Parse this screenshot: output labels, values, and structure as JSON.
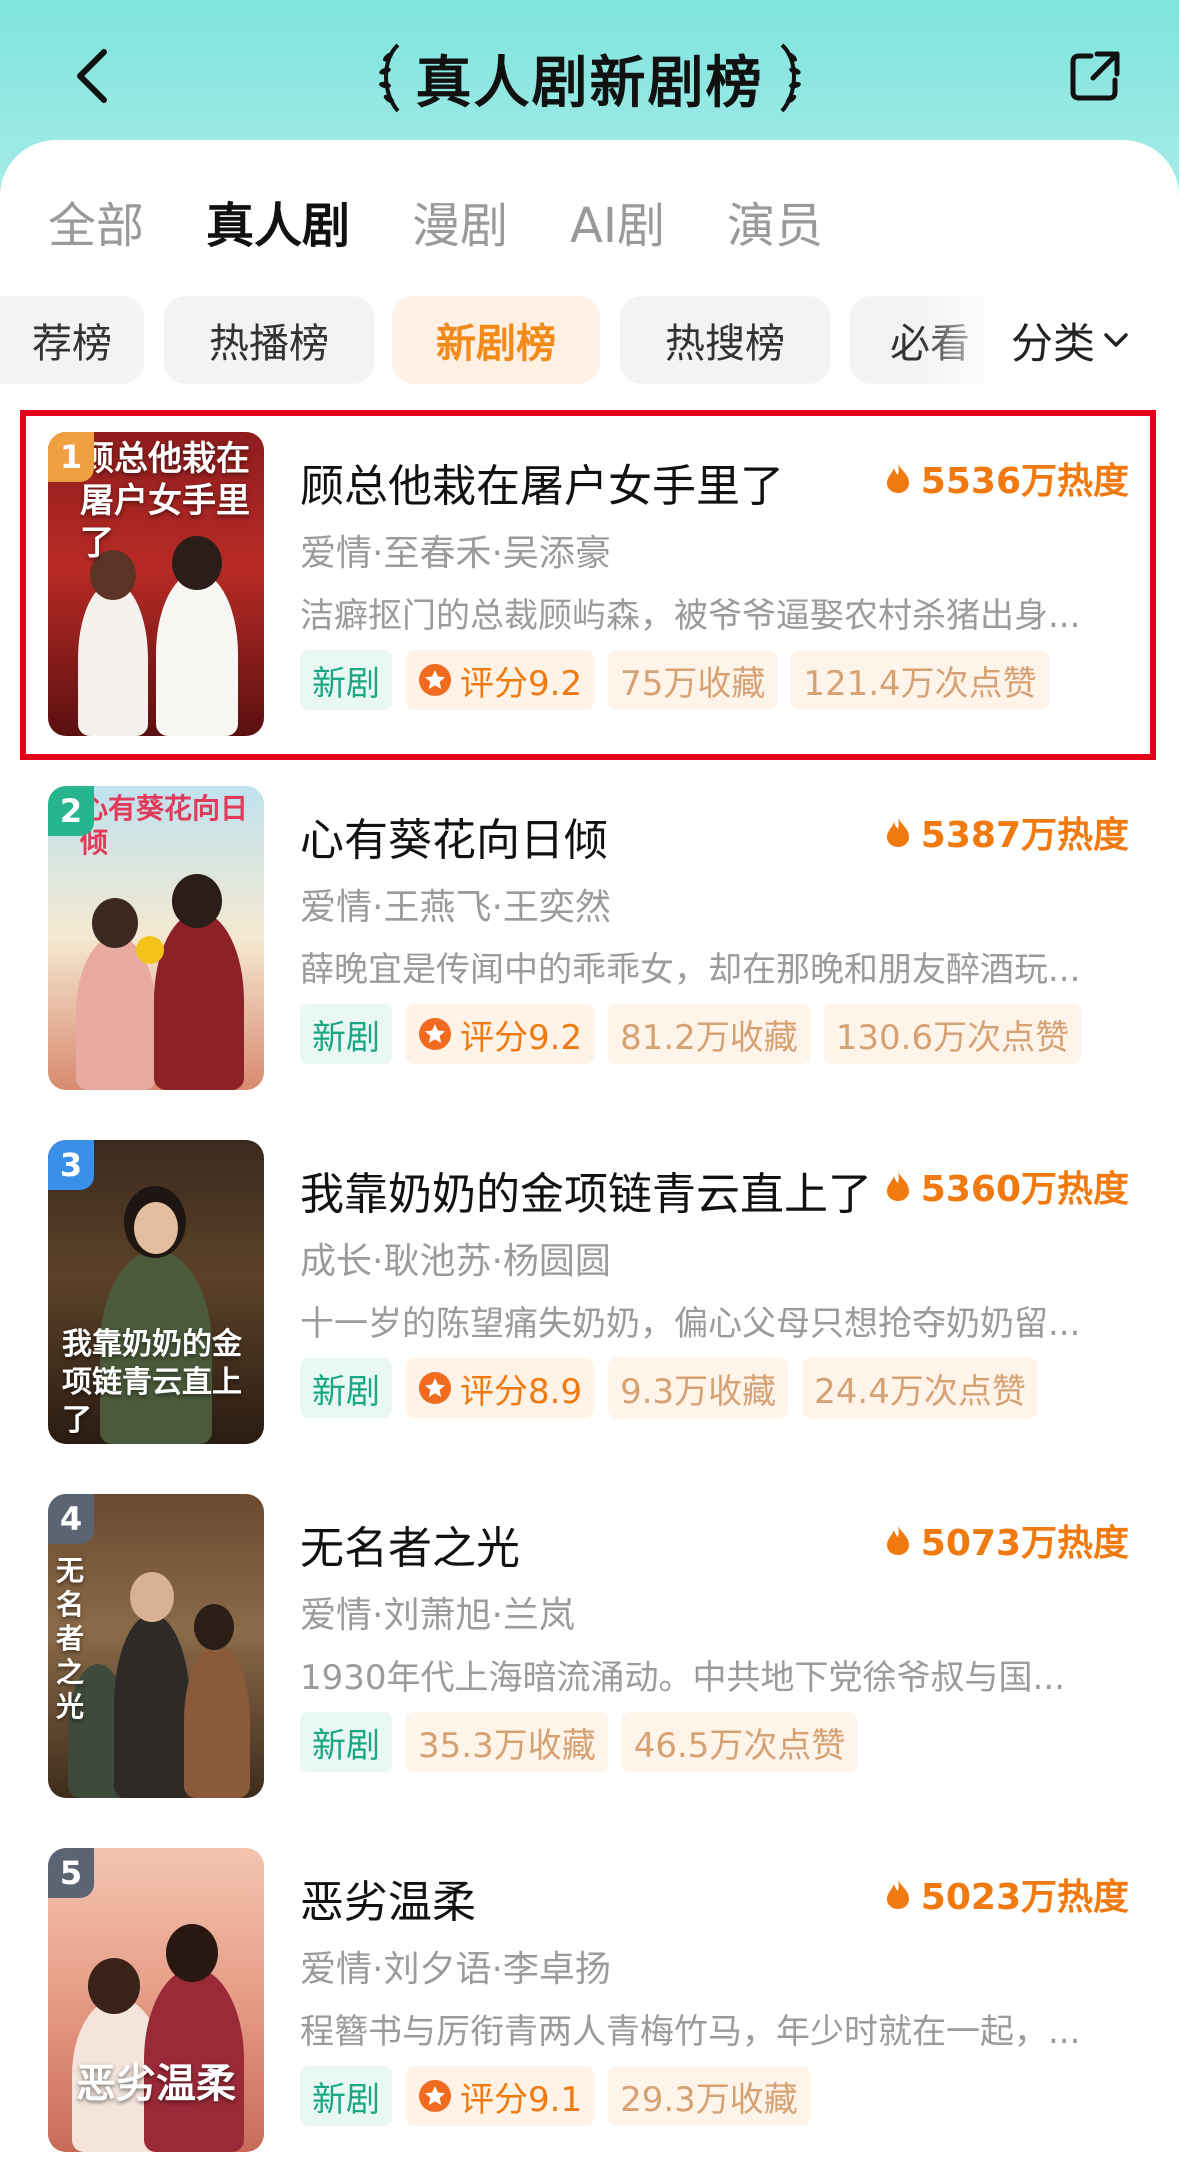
{
  "header": {
    "title": "真人剧新剧榜",
    "back_icon": "chevron-left-icon",
    "share_icon": "share-icon"
  },
  "main_tabs": [
    {
      "label": "全部",
      "active": false
    },
    {
      "label": "真人剧",
      "active": true
    },
    {
      "label": "漫剧",
      "active": false
    },
    {
      "label": "AI剧",
      "active": false
    },
    {
      "label": "演员",
      "active": false
    }
  ],
  "rank_chips": [
    {
      "label": "荐榜",
      "active": false
    },
    {
      "label": "热播榜",
      "active": false
    },
    {
      "label": "新剧榜",
      "active": true
    },
    {
      "label": "热搜榜",
      "active": false
    },
    {
      "label": "必看",
      "active": false
    }
  ],
  "category": {
    "label": "分类",
    "icon": "chevron-down-icon"
  },
  "colors": {
    "accent_orange": "#f07a10",
    "new_tag_green": "#1aa884",
    "highlight_red": "#e4001b",
    "header_teal": "#7fe3dd"
  },
  "items": [
    {
      "rank": "1",
      "badge_color": "#f0a040",
      "poster_title": "顾总他栽在屠户女手里了",
      "title": "顾总他栽在屠户女手里了",
      "heat": "5536万热度",
      "genre": "爱情·至春禾·吴添豪",
      "desc": "洁癖抠门的总裁顾屿森，被爷爷逼娶农村杀猪出身...",
      "tag_new": "新剧",
      "rating": "评分9.2",
      "favorites": "75万收藏",
      "likes": "121.4万次点赞"
    },
    {
      "rank": "2",
      "badge_color": "#26b58e",
      "poster_title": "心有葵花向日倾",
      "title": "心有葵花向日倾",
      "heat": "5387万热度",
      "genre": "爱情·王燕飞·王奕然",
      "desc": "薛晚宜是传闻中的乖乖女，却在那晚和朋友醉酒玩...",
      "tag_new": "新剧",
      "rating": "评分9.2",
      "favorites": "81.2万收藏",
      "likes": "130.6万次点赞"
    },
    {
      "rank": "3",
      "badge_color": "#3a8fe8",
      "poster_title": "我靠奶奶的金项链青云直上了",
      "title": "我靠奶奶的金项链青云直上了",
      "heat": "5360万热度",
      "genre": "成长·耿池苏·杨圆圆",
      "desc": "十一岁的陈望痛失奶奶，偏心父母只想抢夺奶奶留...",
      "tag_new": "新剧",
      "rating": "评分8.9",
      "favorites": "9.3万收藏",
      "likes": "24.4万次点赞"
    },
    {
      "rank": "4",
      "badge_color": "#5b6472",
      "poster_title": "无名者之光",
      "title": "无名者之光",
      "heat": "5073万热度",
      "genre": "爱情·刘萧旭·兰岚",
      "desc": "1930年代上海暗流涌动。中共地下党徐爷叔与国...",
      "tag_new": "新剧",
      "rating": "",
      "favorites": "35.3万收藏",
      "likes": "46.5万次点赞"
    },
    {
      "rank": "5",
      "badge_color": "#5b6472",
      "poster_title": "恶劣温柔",
      "title": "恶劣温柔",
      "heat": "5023万热度",
      "genre": "爱情·刘夕语·李卓扬",
      "desc": "程簪书与厉衔青两人青梅竹马，年少时就在一起，...",
      "tag_new": "新剧",
      "rating": "评分9.1",
      "favorites": "29.3万收藏",
      "likes": ""
    }
  ]
}
